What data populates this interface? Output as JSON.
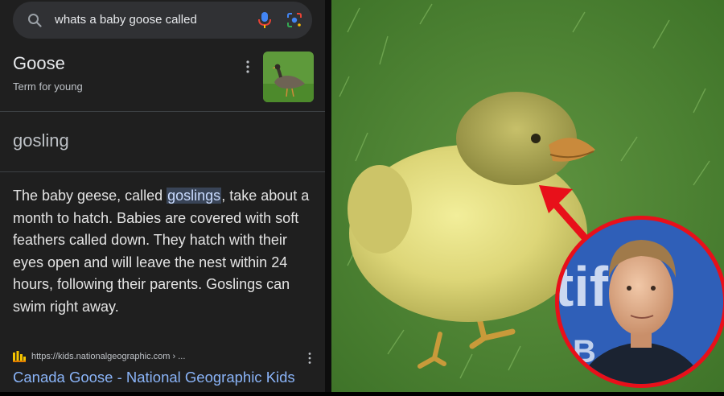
{
  "search": {
    "query": "whats a baby goose called",
    "icons": {
      "search": "search-icon",
      "mic": "mic-icon",
      "lens": "lens-icon"
    }
  },
  "knowledge_panel": {
    "title": "Goose",
    "subtitle": "Term for young",
    "answer": "gosling",
    "thumbnail": "goose-thumbnail"
  },
  "snippet": {
    "text_before": "The baby geese, called ",
    "highlight": "goslings",
    "text_after": ", take about a month to hatch. Babies are covered with soft feathers called down. They hatch with their eyes open and will leave the nest within 24 hours, following their parents. Goslings can swim right away."
  },
  "source": {
    "url": "https://kids.nationalgeographic.com › ...",
    "link_title": "Canada Goose - National Geographic Kids"
  },
  "colors": {
    "background": "#1f1f1f",
    "link": "#8ab4f8",
    "highlight_bg": "#394457",
    "circle_stroke": "#e8101a",
    "arrow": "#e8101a"
  },
  "right_image": {
    "subject": "gosling-photo",
    "inset": "actor-portrait"
  }
}
